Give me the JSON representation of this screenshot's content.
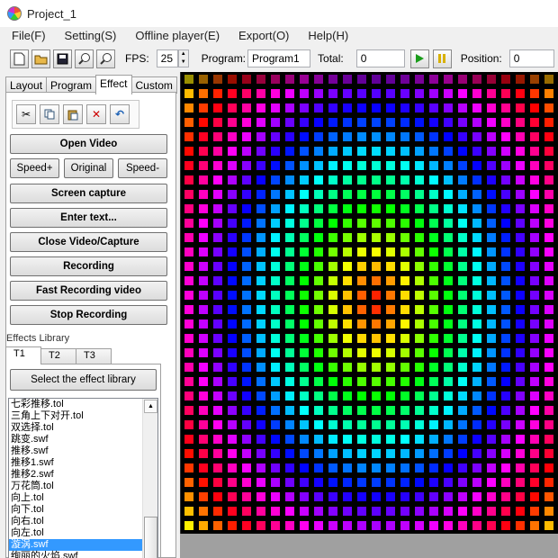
{
  "window": {
    "title": "Project_1"
  },
  "menu": [
    "File(F)",
    "Setting(S)",
    "Offline player(E)",
    "Export(O)",
    "Help(H)"
  ],
  "toolbar": {
    "icons": [
      "new-file-icon",
      "open-folder-icon",
      "save-icon",
      "zoom-in-icon",
      "zoom-out-icon"
    ],
    "fps_label": "FPS:",
    "fps_value": "25",
    "program_label": "Program:",
    "program_value": "Program1",
    "total_label": "Total:",
    "total_value": "0",
    "position_label": "Position:",
    "position_value": "0"
  },
  "tabs": [
    "Layout",
    "Program",
    "Effect",
    "Custom"
  ],
  "active_tab": "Effect",
  "edit_tools": [
    "cut-icon",
    "copy-icon",
    "paste-icon",
    "delete-icon",
    "undo-icon"
  ],
  "buttons": {
    "open_video": "Open Video",
    "speed_up": "Speed+",
    "original": "Original",
    "speed_down": "Speed-",
    "screen_capture": "Screen capture",
    "enter_text": "Enter text...",
    "close_video": "Close Video/Capture",
    "recording": "Recording",
    "fast_recording": "Fast Recording video",
    "stop_recording": "Stop Recording"
  },
  "library": {
    "title": "Effects Library",
    "tabs": [
      "T1",
      "T2",
      "T3"
    ],
    "active_tab": "T1",
    "select_button": "Select the effect library",
    "items": [
      "七彩推移.tol",
      "三角上下对开.tol",
      "双选择.tol",
      "跳变.swf",
      "推移.swf",
      "推移1.swf",
      "推移2.swf",
      "万花筒.tol",
      "向上.tol",
      "向下.tol",
      "向右.tol",
      "向左.tol",
      "漩涡.swf",
      "绚丽的火焰.swf"
    ],
    "selected_item": "漩涡.swf"
  },
  "colors": {
    "canvas_background": "#000000",
    "pixel_palette": [
      "#ff0000",
      "#ff7f00",
      "#ffff00",
      "#00ff00",
      "#00ffff",
      "#0000ff",
      "#ff00ff"
    ]
  }
}
